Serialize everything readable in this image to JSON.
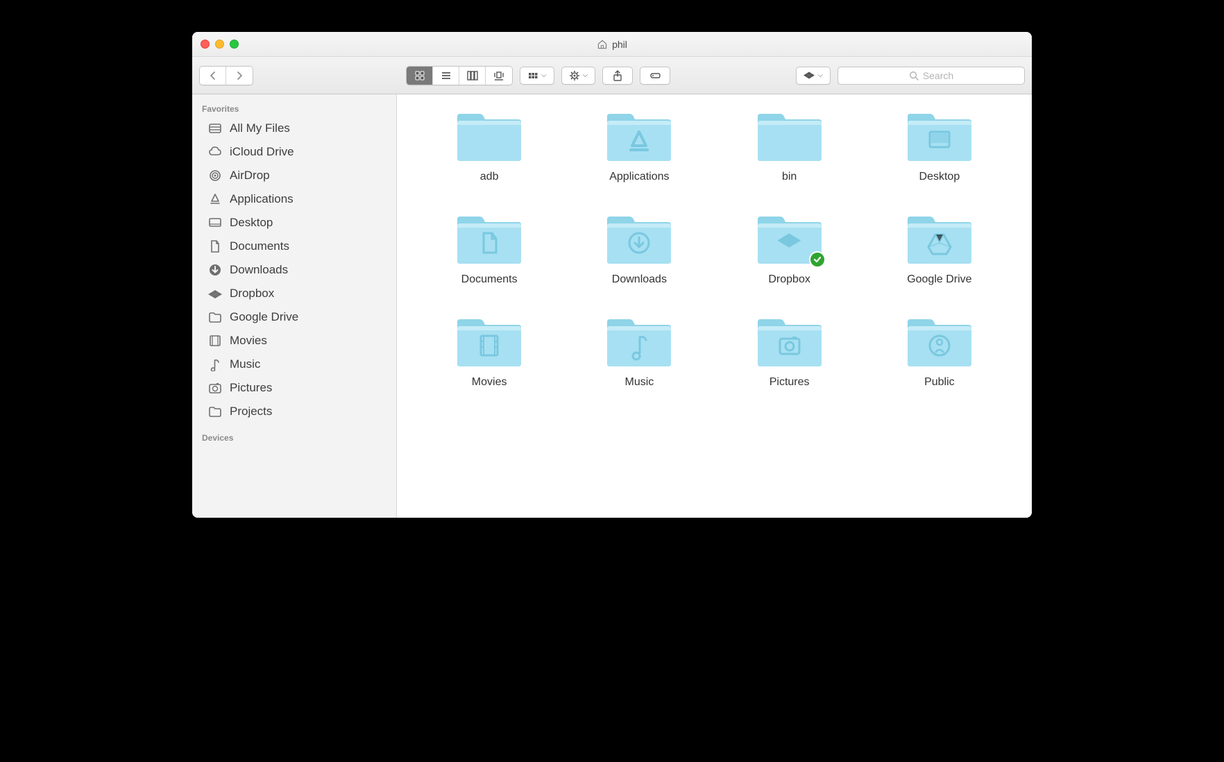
{
  "window": {
    "title": "phil"
  },
  "search": {
    "placeholder": "Search"
  },
  "sidebar": {
    "sections": [
      {
        "header": "Favorites",
        "items": [
          {
            "icon": "all-my-files",
            "label": "All My Files"
          },
          {
            "icon": "icloud",
            "label": "iCloud Drive"
          },
          {
            "icon": "airdrop",
            "label": "AirDrop"
          },
          {
            "icon": "applications",
            "label": "Applications"
          },
          {
            "icon": "desktop",
            "label": "Desktop"
          },
          {
            "icon": "documents",
            "label": "Documents"
          },
          {
            "icon": "downloads",
            "label": "Downloads"
          },
          {
            "icon": "dropbox",
            "label": "Dropbox"
          },
          {
            "icon": "folder",
            "label": "Google Drive"
          },
          {
            "icon": "movies",
            "label": "Movies"
          },
          {
            "icon": "music",
            "label": "Music"
          },
          {
            "icon": "pictures",
            "label": "Pictures"
          },
          {
            "icon": "folder",
            "label": "Projects"
          }
        ]
      },
      {
        "header": "Devices",
        "items": []
      }
    ]
  },
  "files": [
    {
      "name": "adb",
      "glyph": "none",
      "badge": null
    },
    {
      "name": "Applications",
      "glyph": "applications",
      "badge": null
    },
    {
      "name": "bin",
      "glyph": "none",
      "badge": null
    },
    {
      "name": "Desktop",
      "glyph": "desktop",
      "badge": null
    },
    {
      "name": "Documents",
      "glyph": "documents",
      "badge": null
    },
    {
      "name": "Downloads",
      "glyph": "downloads",
      "badge": null
    },
    {
      "name": "Dropbox",
      "glyph": "dropbox",
      "badge": "sync"
    },
    {
      "name": "Google Drive",
      "glyph": "gdrive",
      "badge": null
    },
    {
      "name": "Movies",
      "glyph": "movies",
      "badge": null
    },
    {
      "name": "Music",
      "glyph": "music",
      "badge": null
    },
    {
      "name": "Pictures",
      "glyph": "pictures",
      "badge": null
    },
    {
      "name": "Public",
      "glyph": "public",
      "badge": null
    }
  ],
  "colors": {
    "folder_light": "#a7e0f2",
    "folder_dark": "#79c8e0",
    "folder_tab": "#8fd4e8"
  }
}
